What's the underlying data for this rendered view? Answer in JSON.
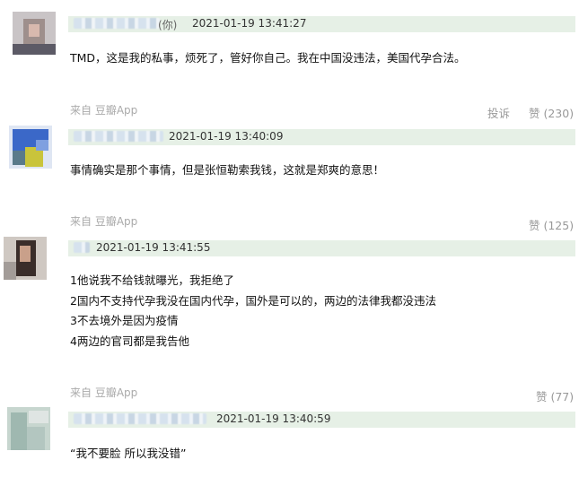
{
  "comments": [
    {
      "name_suffix": "(你)",
      "time": "2021-01-19 13:41:27",
      "lines": [
        "TMD，这是我的私事，烦死了，管好你自己。我在中国没违法，美国代孕合法。"
      ],
      "source": "来自 豆瓣App",
      "report": "投诉",
      "likes": "赞 (230)"
    },
    {
      "time": "2021-01-19 13:40:09",
      "lines": [
        "事情确实是那个事情，但是张恒勒索我钱，这就是郑爽的意思！"
      ],
      "source": "来自 豆瓣App",
      "likes": "赞 (125)"
    },
    {
      "time": "2021-01-19 13:41:55",
      "lines": [
        "1他说我不给钱就曝光，我拒绝了",
        "2国内不支持代孕我没在国内代孕，国外是可以的，两边的法律我都没违法",
        "3不去境外是因为疫情",
        "4两边的官司都是我告他"
      ],
      "source": "来自 豆瓣App",
      "likes": "赞 (77)"
    },
    {
      "time": "2021-01-19 13:40:59",
      "lines": [
        "“我不要脸 所以我没错”"
      ]
    }
  ]
}
